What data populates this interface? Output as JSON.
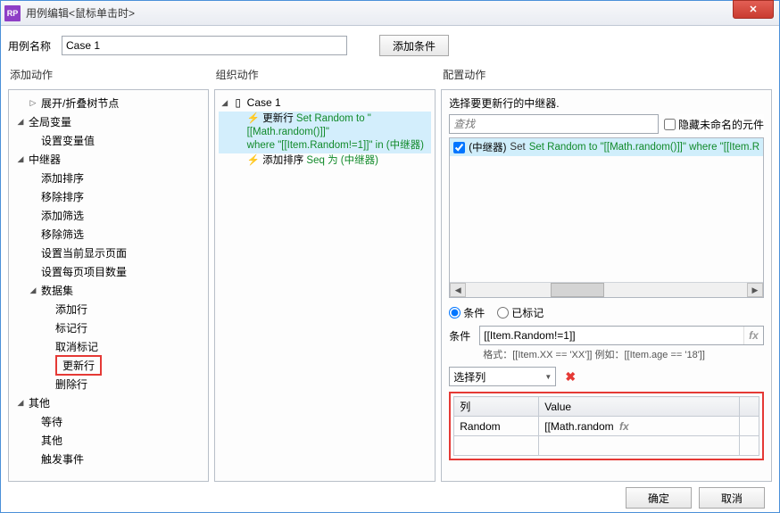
{
  "title": "用例编辑<鼠标单击时>",
  "appIcon": "RP",
  "topRow": {
    "nameLabel": "用例名称",
    "nameValue": "Case 1",
    "addCondition": "添加条件"
  },
  "columns": {
    "left": "添加动作",
    "mid": "组织动作",
    "right": "配置动作"
  },
  "leftTree": [
    {
      "label": "展开/折叠树节点",
      "type": "leaf",
      "depth": 1,
      "twisty": "▷"
    },
    {
      "label": "全局变量",
      "type": "group",
      "depth": 0,
      "twisty": "◢"
    },
    {
      "label": "设置变量值",
      "type": "leaf",
      "depth": 1
    },
    {
      "label": "中继器",
      "type": "group",
      "depth": 0,
      "twisty": "◢"
    },
    {
      "label": "添加排序",
      "type": "leaf",
      "depth": 1
    },
    {
      "label": "移除排序",
      "type": "leaf",
      "depth": 1
    },
    {
      "label": "添加筛选",
      "type": "leaf",
      "depth": 1
    },
    {
      "label": "移除筛选",
      "type": "leaf",
      "depth": 1
    },
    {
      "label": "设置当前显示页面",
      "type": "leaf",
      "depth": 1
    },
    {
      "label": "设置每页项目数量",
      "type": "leaf",
      "depth": 1
    },
    {
      "label": "数据集",
      "type": "group",
      "depth": 1,
      "twisty": "◢"
    },
    {
      "label": "添加行",
      "type": "leaf",
      "depth": 2
    },
    {
      "label": "标记行",
      "type": "leaf",
      "depth": 2
    },
    {
      "label": "取消标记",
      "type": "leaf",
      "depth": 2
    },
    {
      "label": "更新行",
      "type": "leaf",
      "depth": 2,
      "highlight": true
    },
    {
      "label": "删除行",
      "type": "leaf",
      "depth": 2
    },
    {
      "label": "其他",
      "type": "group",
      "depth": 0,
      "twisty": "◢"
    },
    {
      "label": "等待",
      "type": "leaf",
      "depth": 1
    },
    {
      "label": "其他",
      "type": "leaf",
      "depth": 1
    },
    {
      "label": "触发事件",
      "type": "leaf",
      "depth": 1
    }
  ],
  "mid": {
    "caseLabel": "Case 1",
    "action1": {
      "label": "更新行",
      "detail1": "Set Random to \"[[Math.random()]]\"",
      "detail2": "where \"[[Item.Random!=1]]\" in (中继器)"
    },
    "action2": {
      "label": "添加排序",
      "detail": "Seq 为 (中继器)"
    }
  },
  "right": {
    "section1Label": "选择要更新行的中继器.",
    "searchPlaceholder": "查找",
    "hideUnnamedLabel": "隐藏未命名的元件",
    "listItem": {
      "label": "(中继器)",
      "desc": "Set Random to \"[[Math.random()]]\" where \"[[Item.R"
    },
    "radio1": "条件",
    "radio2": "已标记",
    "condLabel": "条件",
    "condValue": "[[Item.Random!=1]]",
    "hint": "格式：[[Item.XX == 'XX']] 例如：[[Item.age == '18']]",
    "selectColLabel": "选择列",
    "tableHeaders": {
      "col": "列",
      "val": "Value"
    },
    "tableRow": {
      "col": "Random",
      "val": "[[Math.random"
    },
    "fx": "fx"
  },
  "footer": {
    "ok": "确定",
    "cancel": "取消"
  }
}
